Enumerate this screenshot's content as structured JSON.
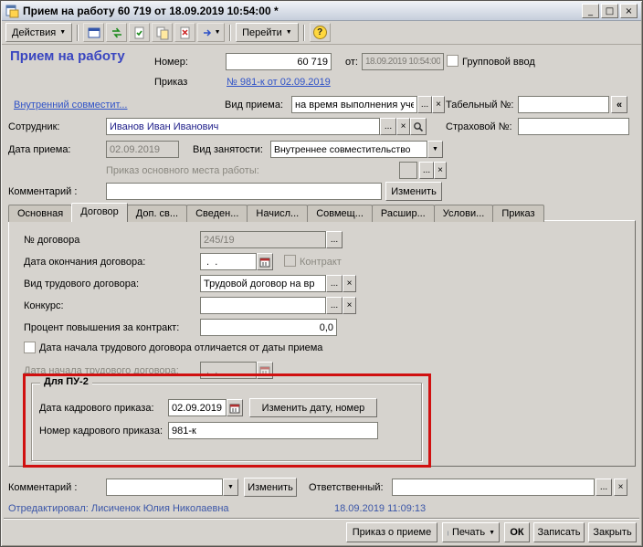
{
  "window": {
    "title": "Прием на работу 60 719 от 18.09.2019 10:54:00 *",
    "minimize": "_",
    "maximize": "□",
    "close": "×"
  },
  "toolbar": {
    "actions_label": "Действия",
    "goto_label": "Перейти"
  },
  "glyphs": {
    "dropdown": "▼",
    "ellipsis": "...",
    "clear": "×",
    "expand": "«",
    "help": "?"
  },
  "header": {
    "form_title": "Прием на работу",
    "number_label": "Номер:",
    "number_value": "60 719",
    "from_label": "от:",
    "datetime_value": "18.09.2019 10:54:00",
    "group_entry_label": "Групповой ввод",
    "order_label": "Приказ",
    "order_link": "№ 981-к от 02.09.2019",
    "employment_link": "Внутренний совместит...",
    "hire_type_label": "Вид приема:",
    "hire_type_value": "на время выполнения уче",
    "personnel_number_label": "Табельный №:",
    "employee_label": "Сотрудник:",
    "employee_value": "Иванов Иван Иванович",
    "insurance_number_label": "Страховой №:",
    "hire_date_label": "Дата приема:",
    "hire_date_value": "02.09.2019",
    "employment_kind_label": "Вид занятости:",
    "employment_kind_value": "Внутреннее совместительство",
    "main_workplace_order_label": "Приказ основного места работы:",
    "comment_label": "Комментарий :",
    "change_label": "Изменить"
  },
  "tabs": [
    "Основная",
    "Договор",
    "Доп. св...",
    "Сведен...",
    "Начисл...",
    "Совмещ...",
    "Расшир...",
    "Услови...",
    "Приказ"
  ],
  "active_tab": "Договор",
  "contract_tab": {
    "contract_number_label": "№ договора",
    "contract_number_value": "245/19",
    "end_date_label": "Дата окончания договора:",
    "end_date_value": " .  .",
    "contract_checkbox_label": "Контракт",
    "contract_type_label": "Вид трудового договора:",
    "contract_type_value": "Трудовой договор на вр",
    "competition_label": "Конкурс:",
    "raise_percent_label": "Процент повышения за контракт:",
    "raise_percent_value": "0,0",
    "start_date_differs_label": "Дата начала трудового договора отличается от даты приема",
    "start_date_label": "Дата начала трудового договора:",
    "start_date_value": " .  .",
    "pu2_group_title": "Для ПУ-2",
    "pu2_date_label": "Дата кадрового приказа:",
    "pu2_date_value": "02.09.2019",
    "pu2_change_button": "Изменить дату, номер",
    "pu2_number_label": "Номер кадрового приказа:",
    "pu2_number_value": "981-к"
  },
  "footer": {
    "comment_label": "Комментарий :",
    "change_label": "Изменить",
    "responsible_label": "Ответственный:",
    "edited_by": "Отредактировал: Лисиченок Юлия Николаевна",
    "edited_at": "18.09.2019 11:09:13",
    "hire_order_button": "Приказ о приеме",
    "print_button": "Печать",
    "ok_button": "ОК",
    "save_button": "Записать",
    "close_button": "Закрыть"
  },
  "colors": {
    "link": "#2f52c8",
    "form_title": "#3a46c0",
    "highlight_red": "#d01010"
  }
}
